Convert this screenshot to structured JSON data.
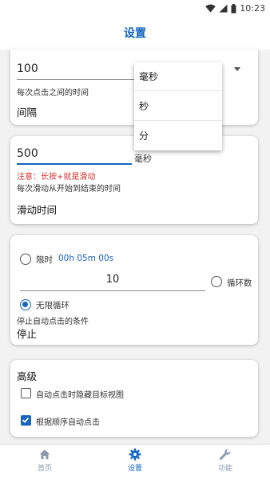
{
  "status_bar": {
    "time": "10:23"
  },
  "app_bar": {
    "title": "设置"
  },
  "interval_card": {
    "value": "100",
    "helper": "每次点击之间的时间",
    "label": "间隔",
    "unit_menu": {
      "items": [
        "毫秒",
        "秒",
        "分"
      ]
    }
  },
  "swipe_card": {
    "value": "500",
    "unit": "毫秒",
    "warning": "注意：长按+就是滑动",
    "helper": "每次滑动从开始到结束的时间",
    "label": "滑动时间"
  },
  "stop_card": {
    "time_limit_label": "限时",
    "time_limit_value": "00h 05m 00s",
    "cycle_count_value": "10",
    "cycle_count_label": "循环数",
    "infinite_label": "无限循环",
    "helper": "停止自动点击的条件",
    "label": "停止"
  },
  "advanced_card": {
    "title": "高级",
    "hide_target_label": "自动点击时隐藏目标视图",
    "hide_target_checked": false,
    "sequential_label": "根据顺序自动点击",
    "sequential_checked": true
  },
  "bottom_nav": {
    "items": [
      {
        "label": "首页",
        "icon": "home-icon",
        "active": false
      },
      {
        "label": "设置",
        "icon": "gear-icon",
        "active": true
      },
      {
        "label": "功能",
        "icon": "wrench-icon",
        "active": false
      }
    ]
  },
  "colors": {
    "accent": "#1565c0",
    "warning": "#d32f2f",
    "inactive": "#8a9bb0"
  }
}
